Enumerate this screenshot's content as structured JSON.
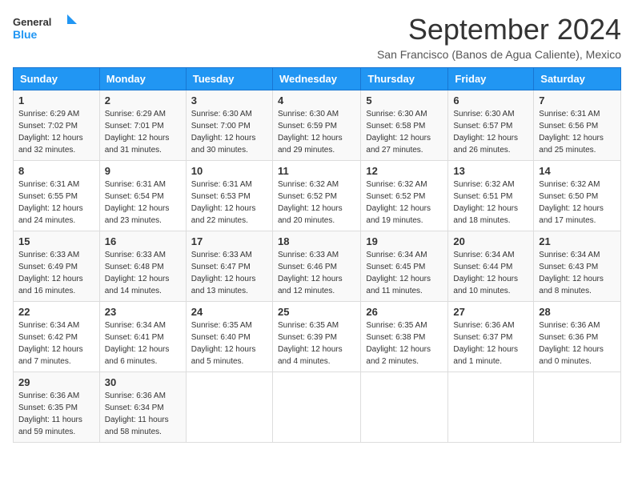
{
  "header": {
    "logo_line1": "General",
    "logo_line2": "Blue",
    "month": "September 2024",
    "location": "San Francisco (Banos de Agua Caliente), Mexico"
  },
  "weekdays": [
    "Sunday",
    "Monday",
    "Tuesday",
    "Wednesday",
    "Thursday",
    "Friday",
    "Saturday"
  ],
  "weeks": [
    [
      {
        "day": "1",
        "sunrise": "6:29 AM",
        "sunset": "7:02 PM",
        "daylight": "12 hours and 32 minutes."
      },
      {
        "day": "2",
        "sunrise": "6:29 AM",
        "sunset": "7:01 PM",
        "daylight": "12 hours and 31 minutes."
      },
      {
        "day": "3",
        "sunrise": "6:30 AM",
        "sunset": "7:00 PM",
        "daylight": "12 hours and 30 minutes."
      },
      {
        "day": "4",
        "sunrise": "6:30 AM",
        "sunset": "6:59 PM",
        "daylight": "12 hours and 29 minutes."
      },
      {
        "day": "5",
        "sunrise": "6:30 AM",
        "sunset": "6:58 PM",
        "daylight": "12 hours and 27 minutes."
      },
      {
        "day": "6",
        "sunrise": "6:30 AM",
        "sunset": "6:57 PM",
        "daylight": "12 hours and 26 minutes."
      },
      {
        "day": "7",
        "sunrise": "6:31 AM",
        "sunset": "6:56 PM",
        "daylight": "12 hours and 25 minutes."
      }
    ],
    [
      {
        "day": "8",
        "sunrise": "6:31 AM",
        "sunset": "6:55 PM",
        "daylight": "12 hours and 24 minutes."
      },
      {
        "day": "9",
        "sunrise": "6:31 AM",
        "sunset": "6:54 PM",
        "daylight": "12 hours and 23 minutes."
      },
      {
        "day": "10",
        "sunrise": "6:31 AM",
        "sunset": "6:53 PM",
        "daylight": "12 hours and 22 minutes."
      },
      {
        "day": "11",
        "sunrise": "6:32 AM",
        "sunset": "6:52 PM",
        "daylight": "12 hours and 20 minutes."
      },
      {
        "day": "12",
        "sunrise": "6:32 AM",
        "sunset": "6:52 PM",
        "daylight": "12 hours and 19 minutes."
      },
      {
        "day": "13",
        "sunrise": "6:32 AM",
        "sunset": "6:51 PM",
        "daylight": "12 hours and 18 minutes."
      },
      {
        "day": "14",
        "sunrise": "6:32 AM",
        "sunset": "6:50 PM",
        "daylight": "12 hours and 17 minutes."
      }
    ],
    [
      {
        "day": "15",
        "sunrise": "6:33 AM",
        "sunset": "6:49 PM",
        "daylight": "12 hours and 16 minutes."
      },
      {
        "day": "16",
        "sunrise": "6:33 AM",
        "sunset": "6:48 PM",
        "daylight": "12 hours and 14 minutes."
      },
      {
        "day": "17",
        "sunrise": "6:33 AM",
        "sunset": "6:47 PM",
        "daylight": "12 hours and 13 minutes."
      },
      {
        "day": "18",
        "sunrise": "6:33 AM",
        "sunset": "6:46 PM",
        "daylight": "12 hours and 12 minutes."
      },
      {
        "day": "19",
        "sunrise": "6:34 AM",
        "sunset": "6:45 PM",
        "daylight": "12 hours and 11 minutes."
      },
      {
        "day": "20",
        "sunrise": "6:34 AM",
        "sunset": "6:44 PM",
        "daylight": "12 hours and 10 minutes."
      },
      {
        "day": "21",
        "sunrise": "6:34 AM",
        "sunset": "6:43 PM",
        "daylight": "12 hours and 8 minutes."
      }
    ],
    [
      {
        "day": "22",
        "sunrise": "6:34 AM",
        "sunset": "6:42 PM",
        "daylight": "12 hours and 7 minutes."
      },
      {
        "day": "23",
        "sunrise": "6:34 AM",
        "sunset": "6:41 PM",
        "daylight": "12 hours and 6 minutes."
      },
      {
        "day": "24",
        "sunrise": "6:35 AM",
        "sunset": "6:40 PM",
        "daylight": "12 hours and 5 minutes."
      },
      {
        "day": "25",
        "sunrise": "6:35 AM",
        "sunset": "6:39 PM",
        "daylight": "12 hours and 4 minutes."
      },
      {
        "day": "26",
        "sunrise": "6:35 AM",
        "sunset": "6:38 PM",
        "daylight": "12 hours and 2 minutes."
      },
      {
        "day": "27",
        "sunrise": "6:36 AM",
        "sunset": "6:37 PM",
        "daylight": "12 hours and 1 minute."
      },
      {
        "day": "28",
        "sunrise": "6:36 AM",
        "sunset": "6:36 PM",
        "daylight": "12 hours and 0 minutes."
      }
    ],
    [
      {
        "day": "29",
        "sunrise": "6:36 AM",
        "sunset": "6:35 PM",
        "daylight": "11 hours and 59 minutes."
      },
      {
        "day": "30",
        "sunrise": "6:36 AM",
        "sunset": "6:34 PM",
        "daylight": "11 hours and 58 minutes."
      },
      null,
      null,
      null,
      null,
      null
    ]
  ]
}
